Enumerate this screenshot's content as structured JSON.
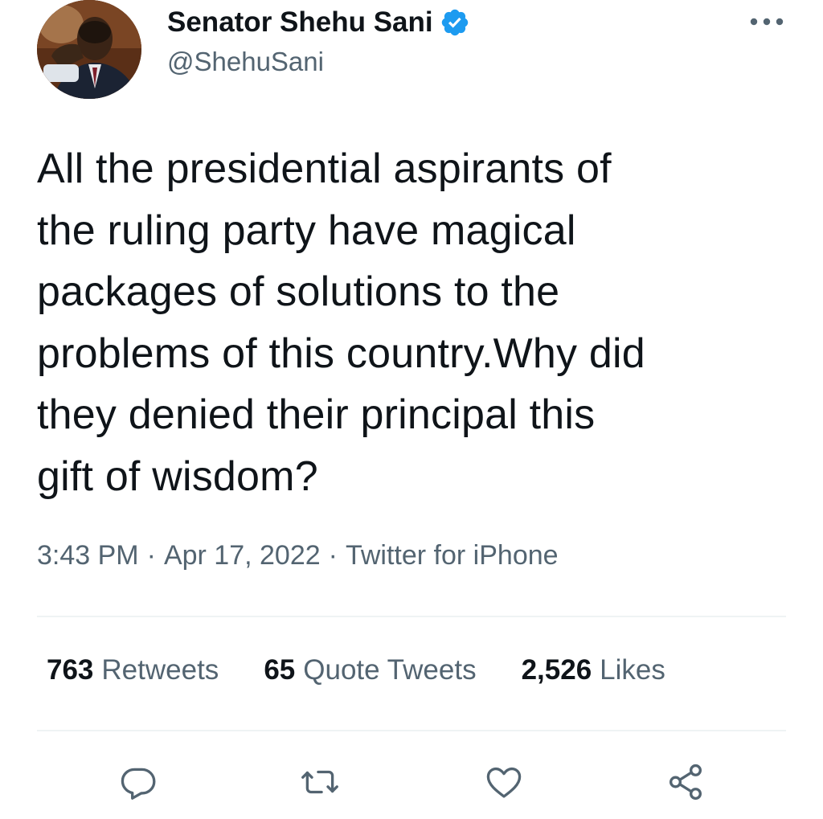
{
  "author": {
    "name": "Senator Shehu Sani",
    "handle": "@ShehuSani",
    "verified": true,
    "avatar_icon": "profile-photo"
  },
  "tweet": {
    "text_lines": [
      "All the presidential aspirants of",
      "the ruling party have magical",
      "packages of solutions to the",
      "problems of this country.Why did",
      "they denied their principal this",
      "gift of wisdom?"
    ]
  },
  "meta": {
    "time": "3:43 PM",
    "separator1": "·",
    "date": "Apr 17, 2022",
    "separator2": "·",
    "source": "Twitter for iPhone"
  },
  "stats": {
    "retweets": {
      "count": "763",
      "label": "Retweets"
    },
    "quote_tweets": {
      "count": "65",
      "label": "Quote Tweets"
    },
    "likes": {
      "count": "2,526",
      "label": "Likes"
    }
  },
  "actions": {
    "reply_icon": "reply-icon",
    "retweet_icon": "retweet-icon",
    "like_icon": "heart-icon",
    "share_icon": "share-icon"
  },
  "colors": {
    "text_primary": "#0f1419",
    "text_secondary": "#536471",
    "verified_blue": "#1d9bf0",
    "divider": "#eff3f4"
  }
}
